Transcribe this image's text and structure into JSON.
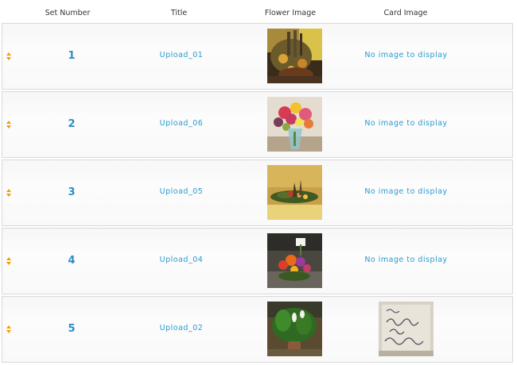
{
  "columns": {
    "set_number": "Set Number",
    "title": "Title",
    "flower_image": "Flower Image",
    "card_image": "Card Image"
  },
  "rows": [
    {
      "set": "1",
      "title": "Upload_01",
      "card": "No image to display"
    },
    {
      "set": "2",
      "title": "Upload_06",
      "card": "No image to display"
    },
    {
      "set": "3",
      "title": "Upload_05",
      "card": "No image to display"
    },
    {
      "set": "4",
      "title": "Upload_04",
      "card": "No image to display"
    },
    {
      "set": "5",
      "title": "Upload_02",
      "card": ""
    }
  ],
  "colors": {
    "link": "#2a9ad0",
    "handle": "#f0a000",
    "row_border": "#d9d9d9"
  },
  "icons": {
    "drag_handle": "sort-arrows-icon"
  }
}
